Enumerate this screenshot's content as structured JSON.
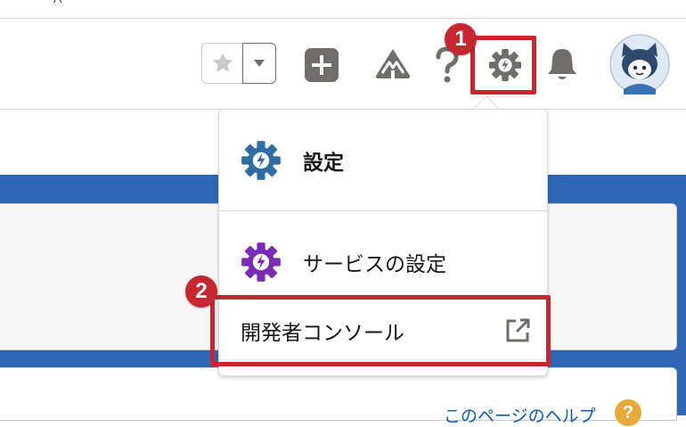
{
  "page": {
    "cut_text": "A"
  },
  "header": {
    "favorites_star": "star-icon",
    "favorites_menu": "chevron-down-icon",
    "global_actions": "add-icon",
    "trailhead": "trailhead-icon",
    "help": "help-icon",
    "setup": "setup-gear-icon",
    "notifications": "bell-icon",
    "avatar": "avatar-icon"
  },
  "callouts": {
    "one": "1",
    "two": "2"
  },
  "menu": {
    "items": [
      {
        "label": "設定",
        "icon": "setup-gear-icon",
        "color": "#2e6da4"
      },
      {
        "label": "サービスの設定",
        "icon": "service-setup-gear-icon",
        "color": "#7b2cb6"
      },
      {
        "label": "開発者コンソール",
        "icon": "external-link-icon"
      }
    ]
  },
  "content": {
    "help_link": "このページのヘルプ",
    "help_badge": "?"
  },
  "colors": {
    "callout": "#c8262e",
    "banner": "#2f66b3",
    "accent_link": "#0b5cab"
  }
}
